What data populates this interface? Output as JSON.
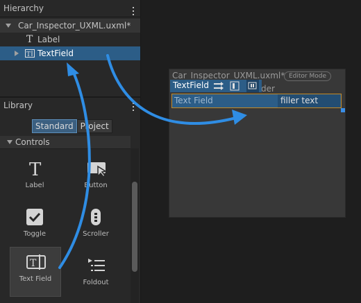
{
  "hierarchy": {
    "title": "Hierarchy",
    "file": "Car_Inspector_UXML.uxml*",
    "items": [
      {
        "icon": "text-label-icon",
        "label": "Label"
      },
      {
        "icon": "textfield-icon",
        "label": "TextField"
      }
    ]
  },
  "library": {
    "title": "Library",
    "tabs": [
      "Standard",
      "Project"
    ],
    "active_tab": "Standard",
    "category": "Controls",
    "controls": [
      {
        "icon": "label-icon",
        "label": "Label"
      },
      {
        "icon": "button-icon",
        "label": "Button"
      },
      {
        "icon": "toggle-icon",
        "label": "Toggle"
      },
      {
        "icon": "scroller-icon",
        "label": "Scroller"
      },
      {
        "icon": "text-field-icon",
        "label": "Text Field"
      },
      {
        "icon": "foldout-icon",
        "label": "Foldout"
      }
    ]
  },
  "canvas": {
    "document_title": "Car_Inspector_UXML.uxml*",
    "badge": "Editor Mode",
    "behind_text": "der",
    "selection_label": "TextField",
    "text_field_label": "Text Field",
    "text_field_value": "filler text"
  },
  "colors": {
    "selection": "#2c5d87",
    "arrow": "#2f8de4",
    "highlight_border": "#c48a26"
  }
}
